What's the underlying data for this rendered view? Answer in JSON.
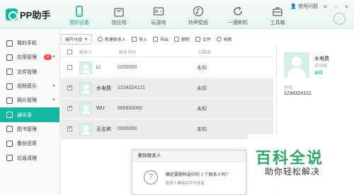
{
  "app": {
    "logo_text": "PP助手"
  },
  "nav": [
    {
      "label": "我的设备",
      "icon": "device-icon",
      "active": true
    },
    {
      "label": "找应用",
      "icon": "bag-icon"
    },
    {
      "label": "玩游戏",
      "icon": "gamepad-icon"
    },
    {
      "label": "铃声壁纸",
      "icon": "music-icon"
    },
    {
      "label": "一键刷机",
      "icon": "refresh-icon"
    },
    {
      "label": "工具箱",
      "icon": "toolbox-icon"
    }
  ],
  "top_right": {
    "feedback": "使用问题",
    "window_controls": [
      "≡",
      "−",
      "×"
    ]
  },
  "sidebar": {
    "items": [
      {
        "label": "我的手机"
      },
      {
        "label": "应用管理",
        "badge": "4"
      },
      {
        "label": "文件管理"
      },
      {
        "label": "视频音乐"
      },
      {
        "label": "照片管理"
      },
      {
        "label": "通讯录",
        "active": true
      },
      {
        "label": "图书管理"
      },
      {
        "label": "备份还原"
      },
      {
        "label": "垃圾清理"
      }
    ]
  },
  "toolbar": {
    "group_label": "展开分组",
    "buttons": [
      "新建联系人",
      "导入",
      "导出",
      "删除",
      "合并",
      "刷新"
    ]
  },
  "table": {
    "headers": [
      "联系人",
      "联系号码",
      "归属地"
    ],
    "rows": [
      {
        "name": "LI",
        "phone": "0250000",
        "location": "未知",
        "checked": false
      },
      {
        "name": "水电费",
        "phone": "1234324121",
        "location": "未知",
        "checked": true
      },
      {
        "name": "WU",
        "phone": "666600000",
        "location": "未知",
        "checked": true
      },
      {
        "name": "无名称",
        "phone": "0000000",
        "location": "未知",
        "checked": true
      }
    ]
  },
  "detail": {
    "name": "水电费",
    "group": "未分组",
    "edit_label": "编辑",
    "phone_label": "住宅",
    "phone": "1234324121"
  },
  "dialog": {
    "title": "删除联系人",
    "message_pre": "确定要删除选中的",
    "count": "3",
    "message_post": "个联系人吗？",
    "sub": "联系人删除后不可恢复"
  },
  "watermark": {
    "main": "百科全说",
    "sub": "助你轻松解决"
  }
}
